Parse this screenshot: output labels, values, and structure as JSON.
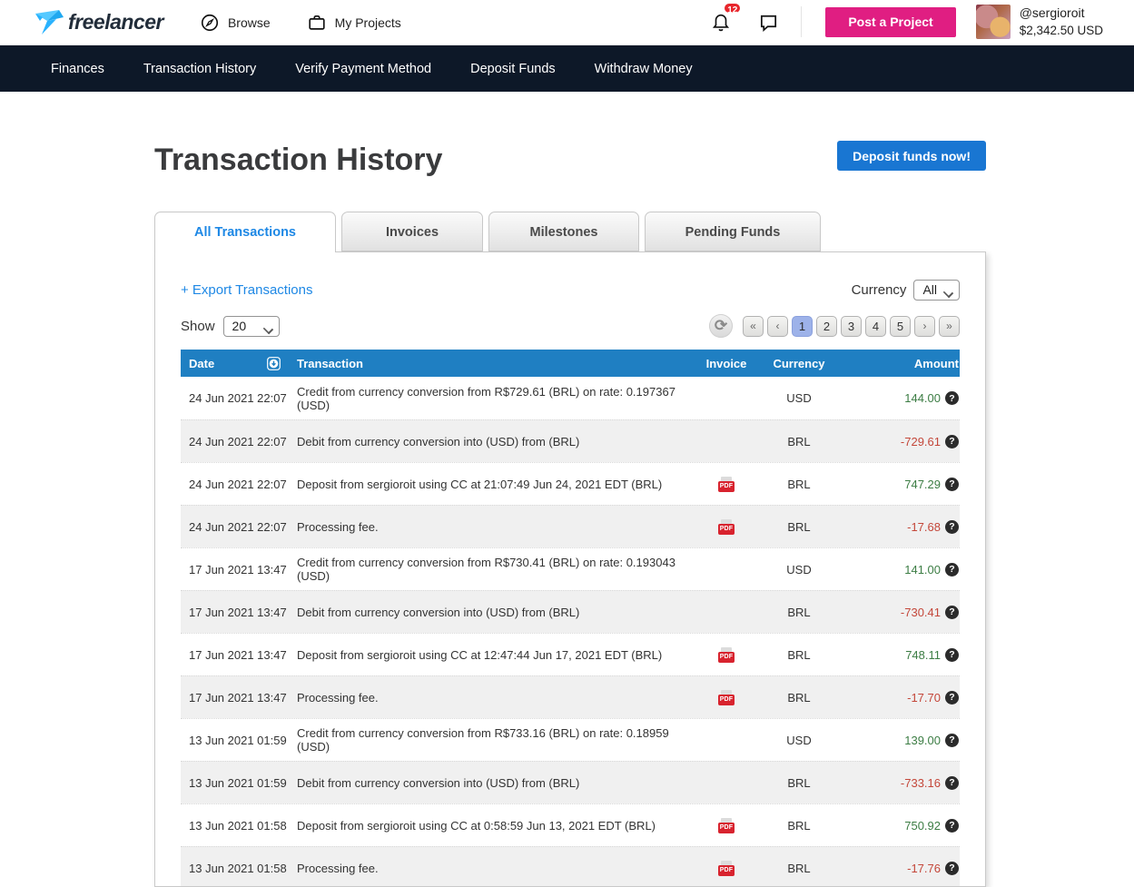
{
  "header": {
    "logo_text": "freelancer",
    "browse_label": "Browse",
    "my_projects_label": "My Projects",
    "notification_count": "12",
    "post_project_label": "Post a Project",
    "username": "@sergioroit",
    "balance": "$2,342.50 USD"
  },
  "subnav": {
    "items": [
      "Finances",
      "Transaction History",
      "Verify Payment Method",
      "Deposit Funds",
      "Withdraw Money"
    ]
  },
  "page": {
    "title": "Transaction History",
    "deposit_button_label": "Deposit funds now!"
  },
  "tabs": [
    {
      "label": "All Transactions",
      "active": true
    },
    {
      "label": "Invoices",
      "active": false
    },
    {
      "label": "Milestones",
      "active": false
    },
    {
      "label": "Pending Funds",
      "active": false
    }
  ],
  "toolbar": {
    "export_label": "+ Export Transactions",
    "currency_label": "Currency",
    "currency_value": "All",
    "show_label": "Show",
    "show_value": "20",
    "pagination": [
      "«",
      "‹",
      "1",
      "2",
      "3",
      "4",
      "5",
      "›",
      "»"
    ],
    "active_page": "1"
  },
  "icons": {
    "refresh_glyph": "⟳",
    "help_glyph": "?",
    "pdf_label": "PDF"
  },
  "table": {
    "headers": {
      "date": "Date",
      "transaction": "Transaction",
      "invoice": "Invoice",
      "currency": "Currency",
      "amount": "Amount"
    },
    "rows": [
      {
        "date": "24 Jun 2021 22:07",
        "transaction": "Credit from currency conversion from R$729.61 (BRL) on rate: 0.197367 (USD)",
        "invoice": false,
        "currency": "USD",
        "amount": "144.00",
        "positive": true
      },
      {
        "date": "24 Jun 2021 22:07",
        "transaction": "Debit from currency conversion into (USD) from (BRL)",
        "invoice": false,
        "currency": "BRL",
        "amount": "-729.61",
        "positive": false
      },
      {
        "date": "24 Jun 2021 22:07",
        "transaction": "Deposit from sergioroit using CC at 21:07:49 Jun 24, 2021 EDT (BRL)",
        "invoice": true,
        "currency": "BRL",
        "amount": "747.29",
        "positive": true
      },
      {
        "date": "24 Jun 2021 22:07",
        "transaction": "Processing fee.",
        "invoice": true,
        "currency": "BRL",
        "amount": "-17.68",
        "positive": false
      },
      {
        "date": "17 Jun 2021 13:47",
        "transaction": "Credit from currency conversion from R$730.41 (BRL) on rate: 0.193043 (USD)",
        "invoice": false,
        "currency": "USD",
        "amount": "141.00",
        "positive": true
      },
      {
        "date": "17 Jun 2021 13:47",
        "transaction": "Debit from currency conversion into (USD) from (BRL)",
        "invoice": false,
        "currency": "BRL",
        "amount": "-730.41",
        "positive": false
      },
      {
        "date": "17 Jun 2021 13:47",
        "transaction": "Deposit from sergioroit using CC at 12:47:44 Jun 17, 2021 EDT (BRL)",
        "invoice": true,
        "currency": "BRL",
        "amount": "748.11",
        "positive": true
      },
      {
        "date": "17 Jun 2021 13:47",
        "transaction": "Processing fee.",
        "invoice": true,
        "currency": "BRL",
        "amount": "-17.70",
        "positive": false
      },
      {
        "date": "13 Jun 2021 01:59",
        "transaction": "Credit from currency conversion from R$733.16 (BRL) on rate: 0.18959 (USD)",
        "invoice": false,
        "currency": "USD",
        "amount": "139.00",
        "positive": true
      },
      {
        "date": "13 Jun 2021 01:59",
        "transaction": "Debit from currency conversion into (USD) from (BRL)",
        "invoice": false,
        "currency": "BRL",
        "amount": "-733.16",
        "positive": false
      },
      {
        "date": "13 Jun 2021 01:58",
        "transaction": "Deposit from sergioroit using CC at 0:58:59 Jun 13, 2021 EDT (BRL)",
        "invoice": true,
        "currency": "BRL",
        "amount": "750.92",
        "positive": true
      },
      {
        "date": "13 Jun 2021 01:58",
        "transaction": "Processing fee.",
        "invoice": true,
        "currency": "BRL",
        "amount": "-17.76",
        "positive": false
      }
    ]
  },
  "colors": {
    "brand_pink": "#e01e82",
    "brand_blue": "#29b2fe",
    "table_header_blue": "#1f7fc2",
    "link_blue": "#1e88e5",
    "deposit_blue": "#1976d2",
    "positive_green": "#3c7d44",
    "negative_red": "#c4473a",
    "subnav_dark": "#0d1828",
    "active_page_bg": "#9db2e9"
  }
}
